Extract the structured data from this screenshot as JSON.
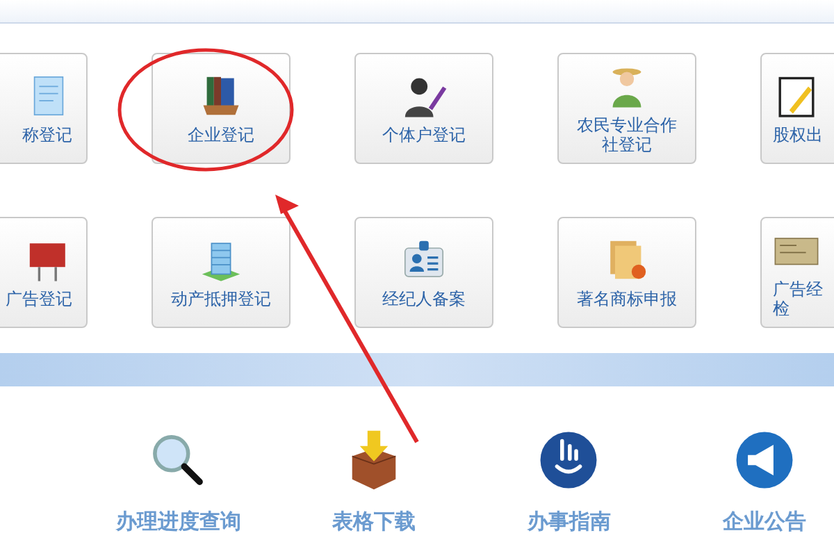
{
  "tiles": [
    {
      "label": "称登记"
    },
    {
      "label": "企业登记"
    },
    {
      "label": "个体户登记"
    },
    {
      "label": "农民专业合作社登记"
    },
    {
      "label": "股权出"
    },
    {
      "label": "广告登记"
    },
    {
      "label": "动产抵押登记"
    },
    {
      "label": "经纪人备案"
    },
    {
      "label": "著名商标申报"
    },
    {
      "label": "广告经检"
    }
  ],
  "services": [
    {
      "label": "办理进度查询"
    },
    {
      "label": "表格下载"
    },
    {
      "label": "办事指南"
    },
    {
      "label": "企业公告"
    }
  ]
}
